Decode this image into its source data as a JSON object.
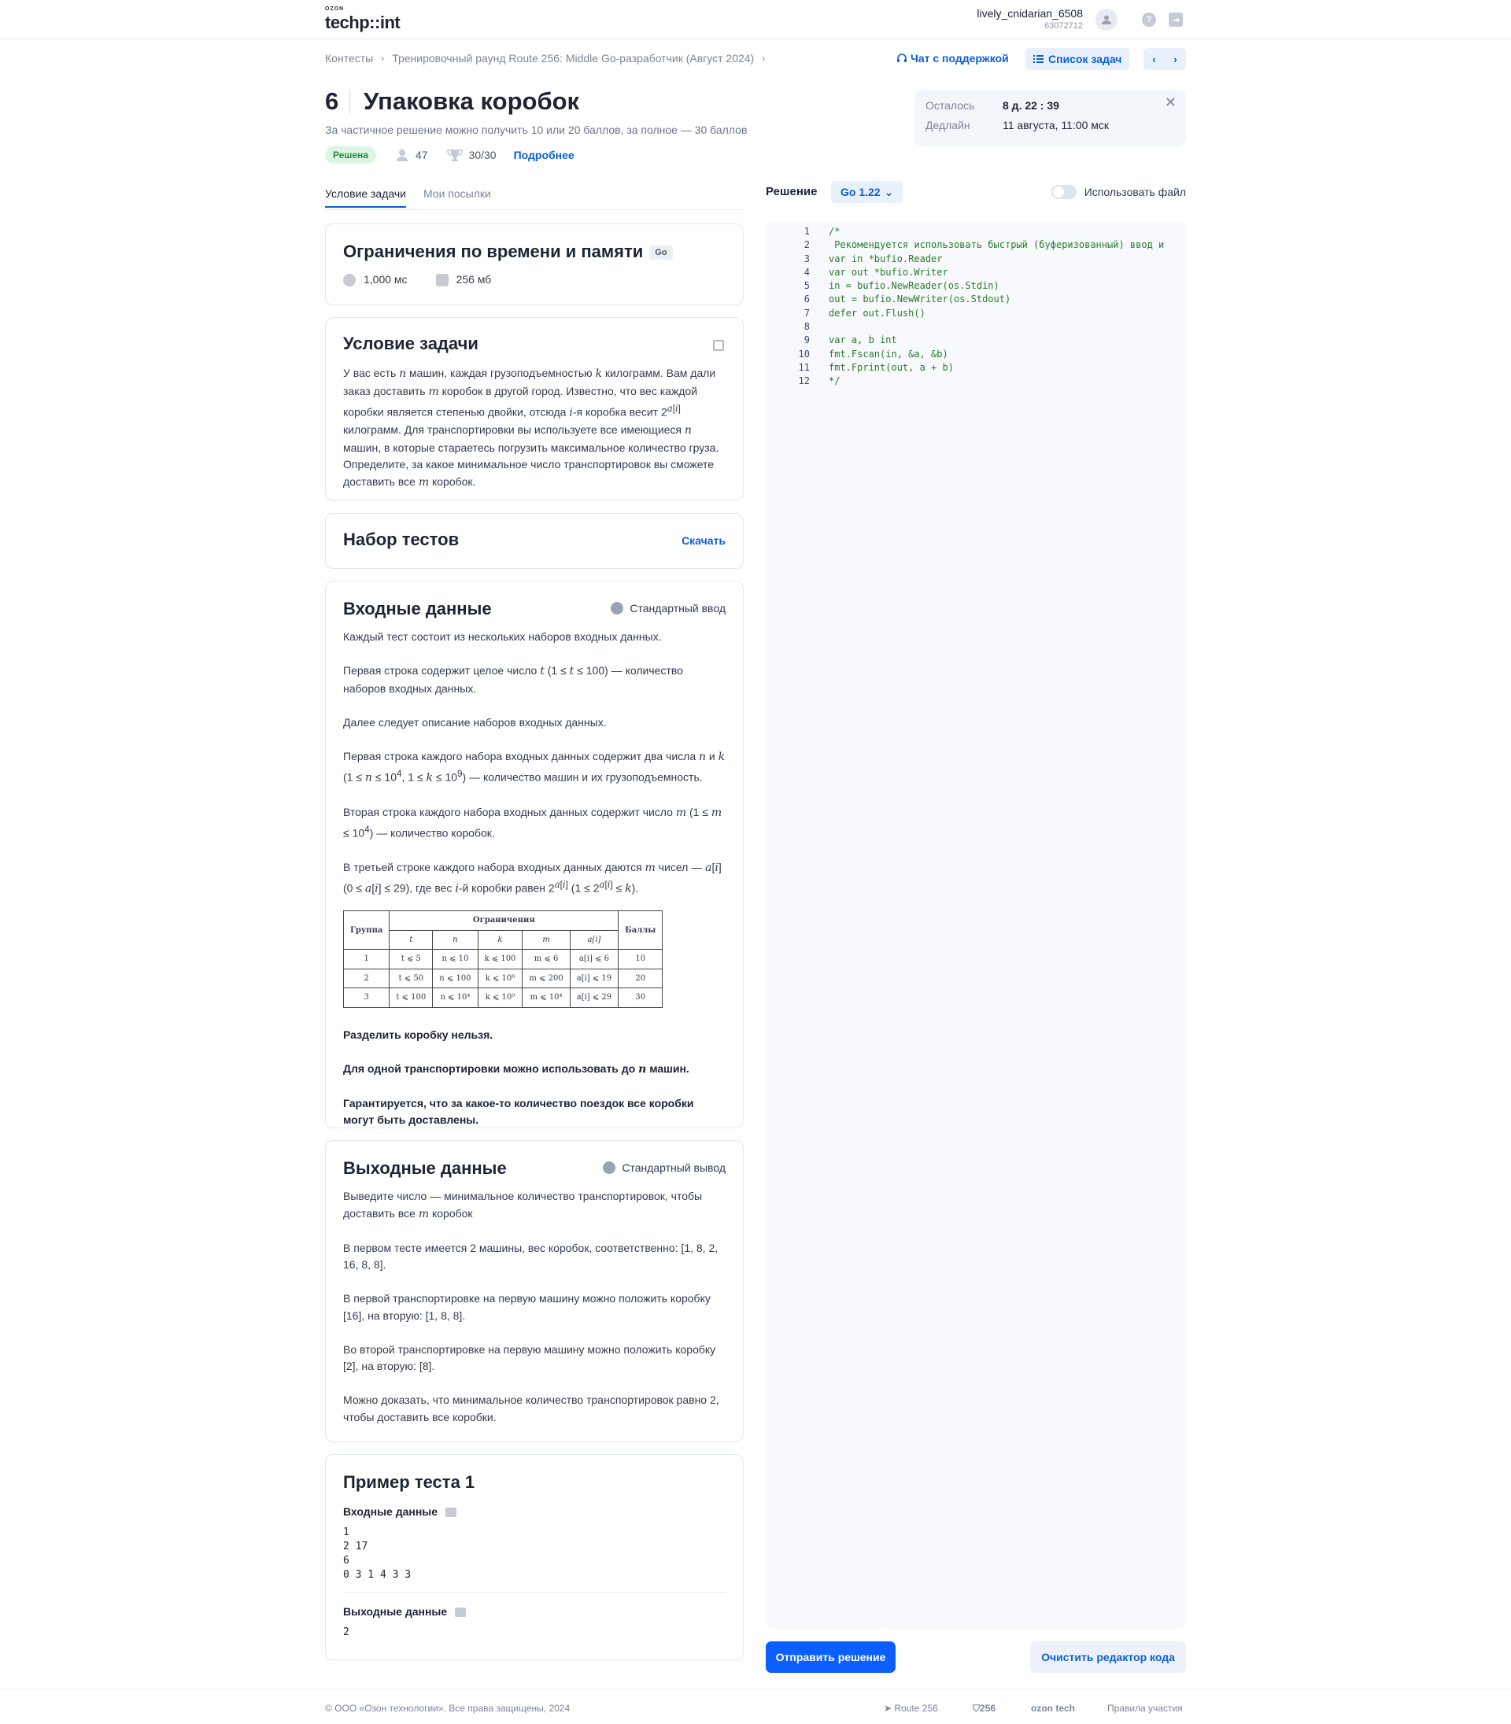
{
  "header": {
    "logo_small": "OZON",
    "logo_main": "techp::int",
    "username": "lively_cnidarian_6508",
    "user_id": "63072712"
  },
  "breadcrumbs": {
    "item1": "Контесты",
    "item2": "Тренировочный раунд Route 256: Middle Go-разработчик (Август 2024)"
  },
  "toolbar": {
    "support": "Чат с поддержкой",
    "task_list": "Список задач"
  },
  "problem": {
    "number": "6",
    "title": "Упаковка коробок",
    "subtitle": "За частичное решение можно получить 10 или 20 баллов, за полное — 30 баллов",
    "status": "Решена",
    "participants": "47",
    "score": "30/30",
    "more": "Подробнее"
  },
  "timer": {
    "left_label": "Осталось",
    "left_value": "8 д. 22 : 39",
    "deadline_label": "Дедлайн",
    "deadline_value": "11 августа, 11:00 мск"
  },
  "tabs": {
    "condition": "Условие задачи",
    "submissions": "Мои посылки"
  },
  "limits": {
    "title": "Ограничения по времени и памяти",
    "lang": "Go",
    "time": "1,000 мс",
    "memory": "256 мб"
  },
  "statement": {
    "title": "Условие задачи"
  },
  "tests": {
    "title": "Набор тестов",
    "download": "Скачать"
  },
  "input": {
    "title": "Входные данные",
    "source": "Стандартный ввод",
    "p1": "Каждый тест состоит из нескольких наборов входных данных.",
    "p3": "Далее следует описание наборов входных данных.",
    "b1": "Разделить коробку нельзя.",
    "b3": "Гарантируется, что за какое-то количество поездок все коробки могут быть доставлены."
  },
  "output": {
    "title": "Выходные данные",
    "target": "Стандартный вывод",
    "p2": "В первом тесте имеется 2 машины, вес коробок, соответственно: [1, 8, 2, 16, 8, 8].",
    "p3": "В первой транспортировке на первую машину можно положить коробку [16], на вторую: [1, 8, 8].",
    "p4": "Во второй транспортировке на первую машину можно положить коробку [2], на вторую: [8].",
    "p5": "Можно доказать, что минимальное количество транспортировок равно 2, чтобы доставить все коробки."
  },
  "example": {
    "title": "Пример теста 1",
    "input_label": "Входные данные",
    "input": "1\n2 17\n6\n0 3 1 4 3 3",
    "output_label": "Выходные данные",
    "output": "2"
  },
  "limits_table": {
    "h_group": "Группа",
    "h_constraints": "Ограничения",
    "h_points": "Баллы",
    "rows": [
      {
        "g": "1",
        "t": "t ⩽ 5",
        "n": "n ⩽ 10",
        "k": "k ⩽ 100",
        "m": "m ⩽ 6",
        "a": "a[i] ⩽ 6",
        "p": "10"
      },
      {
        "g": "2",
        "t": "t ⩽ 50",
        "n": "n ⩽ 100",
        "k": "k ⩽ 10⁶",
        "m": "m ⩽ 200",
        "a": "a[i] ⩽ 19",
        "p": "20"
      },
      {
        "g": "3",
        "t": "t ⩽ 100",
        "n": "n ⩽ 10⁴",
        "k": "k ⩽ 10⁹",
        "m": "m ⩽ 10⁴",
        "a": "a[i] ⩽ 29",
        "p": "30"
      }
    ]
  },
  "editor": {
    "label": "Решение",
    "language": "Go 1.22",
    "use_file": "Использовать файл",
    "code": "/*\n Рекомендуется использовать быстрый (буферизованный) ввод и\nvar in *bufio.Reader\nvar out *bufio.Writer\nin = bufio.NewReader(os.Stdin)\nout = bufio.NewWriter(os.Stdout)\ndefer out.Flush()\n\nvar a, b int\nfmt.Fscan(in, &a, &b)\nfmt.Fprint(out, a + b)\n*/",
    "line_numbers": "1\n2\n3\n4\n5\n6\n7\n8\n9\n10\n11\n12",
    "submit": "Отправить решение",
    "clear": "Очистить редактор кода"
  },
  "footer": {
    "copyright": "© ООО «Озон технологии». Все права защищены, 2024",
    "route": "Route 256",
    "badge": "256",
    "ozontech": "ozon tech",
    "rules": "Правила участия"
  }
}
